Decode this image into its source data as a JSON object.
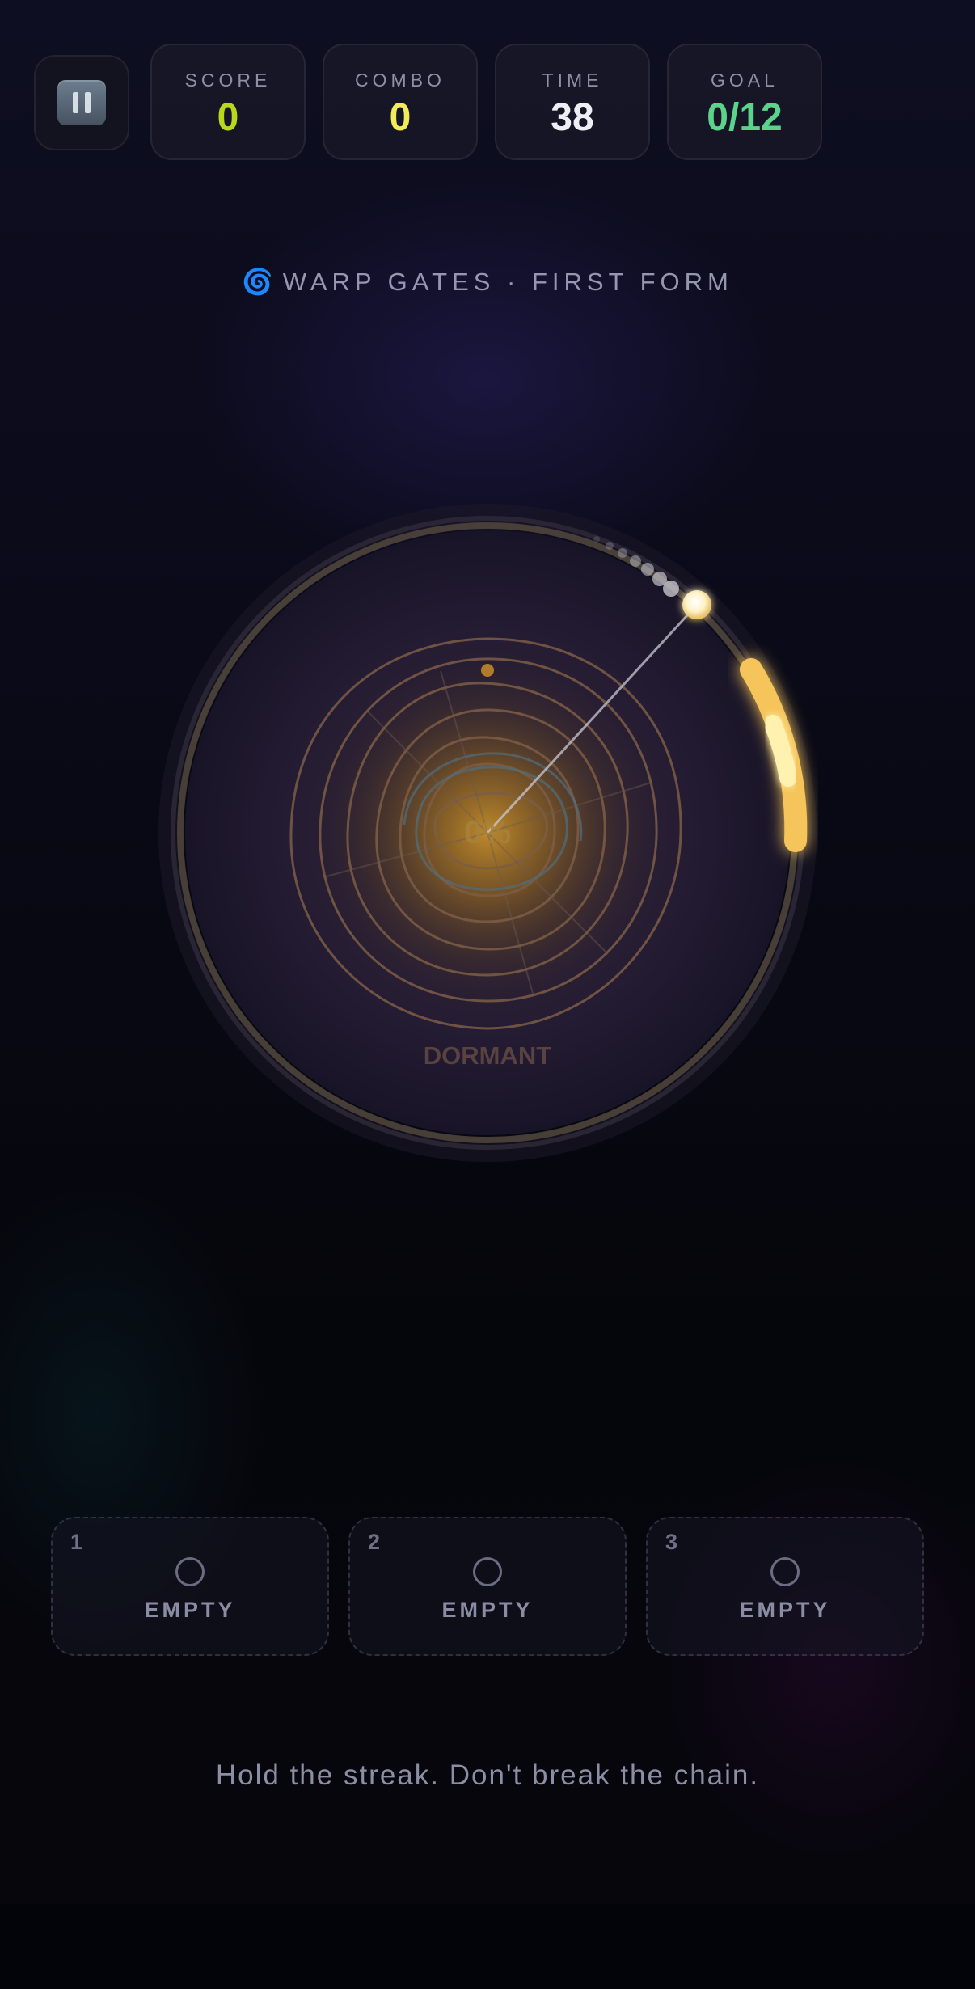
{
  "hud": {
    "pause": {
      "icon": "pause-icon"
    },
    "score": {
      "label": "SCORE",
      "value": "0",
      "color": "#b8d81c"
    },
    "combo": {
      "label": "COMBO",
      "value": "0",
      "color": "#f2ec5a"
    },
    "time": {
      "label": "TIME",
      "value": "38",
      "color": "#eeeef5"
    },
    "goal": {
      "label": "GOAL",
      "value": "0/12",
      "color": "#5bd38a"
    }
  },
  "mode": {
    "icon": "🌀",
    "icon_name": "spiral-icon",
    "title": "WARP GATES · FIRST FORM"
  },
  "gate": {
    "percent_text": "0%",
    "charge_fraction": 0,
    "status": "DORMANT",
    "accent": "#f5c45a"
  },
  "slots": [
    {
      "number": "1",
      "label": "EMPTY"
    },
    {
      "number": "2",
      "label": "EMPTY"
    },
    {
      "number": "3",
      "label": "EMPTY"
    }
  ],
  "footer": {
    "text": "Hold the streak. Don't break the chain."
  }
}
